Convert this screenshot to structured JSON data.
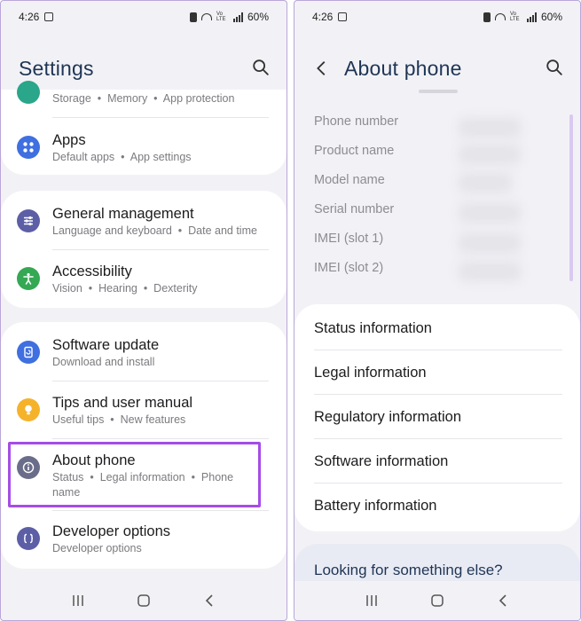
{
  "status_bar": {
    "time": "4:26",
    "battery": "60%"
  },
  "left": {
    "title": "Settings",
    "rows": [
      {
        "label": "",
        "sub": [
          "Storage",
          "Memory",
          "App protection"
        ]
      },
      {
        "label": "Apps",
        "sub": [
          "Default apps",
          "App settings"
        ]
      },
      {
        "label": "General management",
        "sub": [
          "Language and keyboard",
          "Date and time"
        ]
      },
      {
        "label": "Accessibility",
        "sub": [
          "Vision",
          "Hearing",
          "Dexterity"
        ]
      },
      {
        "label": "Software update",
        "sub": [
          "Download and install"
        ]
      },
      {
        "label": "Tips and user manual",
        "sub": [
          "Useful tips",
          "New features"
        ]
      },
      {
        "label": "About phone",
        "sub": [
          "Status",
          "Legal information",
          "Phone name"
        ]
      },
      {
        "label": "Developer options",
        "sub": [
          "Developer options"
        ]
      }
    ]
  },
  "right": {
    "title": "About phone",
    "info_labels": [
      "Phone number",
      "Product name",
      "Model name",
      "Serial number",
      "IMEI (slot 1)",
      "IMEI (slot 2)"
    ],
    "menu": [
      "Status information",
      "Legal information",
      "Regulatory information",
      "Software information",
      "Battery information"
    ],
    "looking": "Looking for something else?"
  },
  "colors": {
    "storage": "#2aa68a",
    "apps": "#3f6fe0",
    "general": "#5c5fa6",
    "accessibility": "#34a853",
    "software": "#3f6fe0",
    "tips": "#f5b32c",
    "about": "#6a6d8a",
    "developer": "#5c5fa6",
    "highlight": "#a54ce6"
  }
}
